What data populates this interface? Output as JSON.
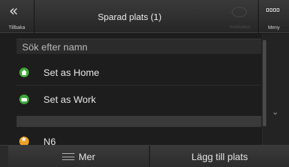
{
  "header": {
    "back_chevron": "«",
    "back_label": "Tillbaka",
    "title": "Sparad plats (1)",
    "notification_label": "Notification",
    "menu_label": "Meny"
  },
  "search": {
    "placeholder": "Sök efter namn"
  },
  "list": {
    "items": [
      {
        "label": "Set as Home",
        "icon": "home-icon"
      },
      {
        "label": "Set as Work",
        "icon": "briefcase-icon"
      },
      {
        "label": "N6",
        "icon": "star-icon"
      }
    ]
  },
  "scroll": {
    "down_glyph": "⌄"
  },
  "footer": {
    "more_label": "Mer",
    "add_label": "Lägg till plats"
  },
  "colors": {
    "accent_green": "#3fa73a",
    "accent_orange": "#e9a126"
  }
}
